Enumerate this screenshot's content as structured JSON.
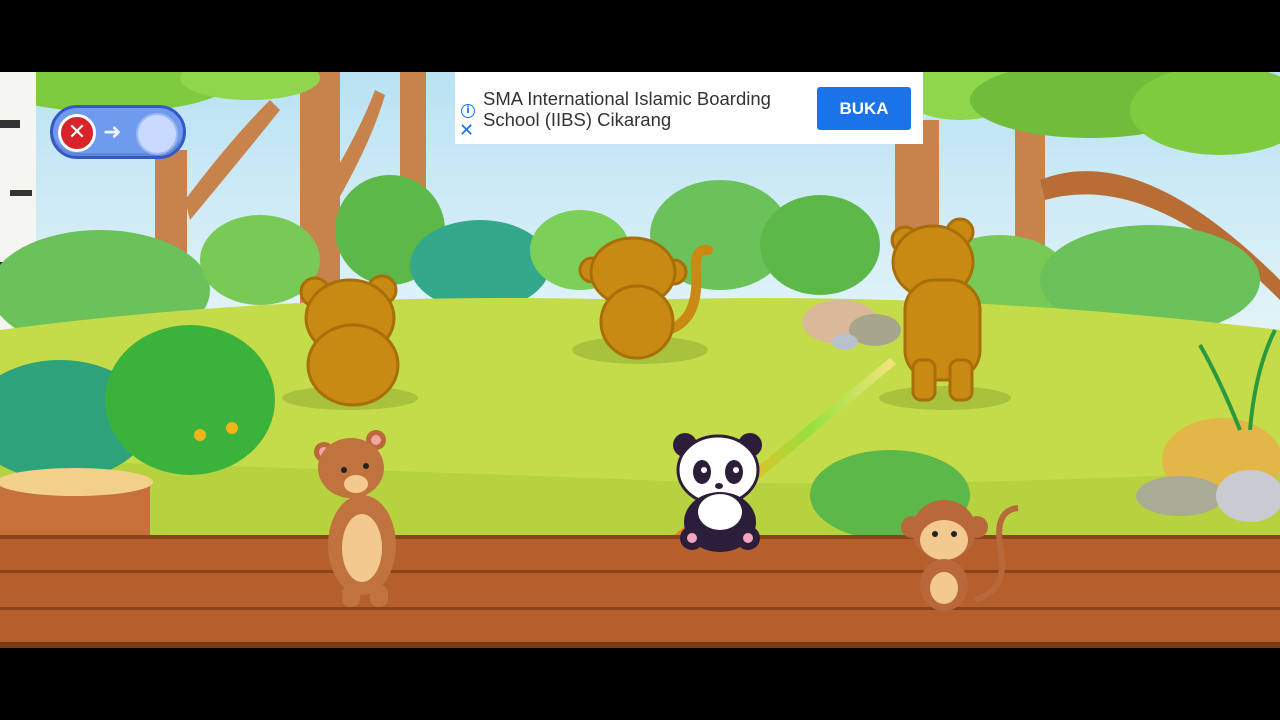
{
  "game": {
    "exit_toggle": {
      "close_icon": "close-icon",
      "arrow_icon": "arrow-right-icon"
    },
    "silhouettes": [
      "bear",
      "monkey",
      "bear"
    ],
    "characters": [
      "bear",
      "panda",
      "monkey"
    ]
  },
  "ad": {
    "info_icon": "info-icon",
    "close_icon": "close-icon",
    "text_line1": "SMA International Islamic Boarding",
    "text_line2": "School (IIBS) Cikarang",
    "cta_label": "BUKA",
    "cta_color": "#1a73e8"
  },
  "colors": {
    "sky": "#cfeaf5",
    "meadow": "#c5dc4a",
    "wood": "#b5602c",
    "silhouette": "#c98a14",
    "toggle": "#6f9bef"
  }
}
